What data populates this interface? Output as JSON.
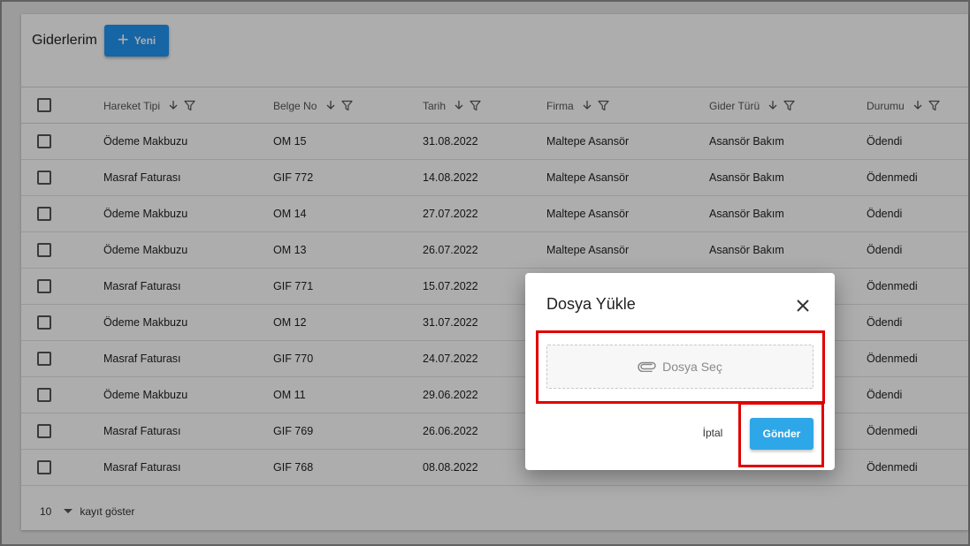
{
  "page": {
    "title": "Giderlerim",
    "new_button_label": "Yeni"
  },
  "table": {
    "columns": [
      "Hareket Tipi",
      "Belge No",
      "Tarih",
      "Firma",
      "Gider Türü",
      "Durumu"
    ],
    "rows": [
      [
        "Ödeme Makbuzu",
        "OM 15",
        "31.08.2022",
        "Maltepe Asansör",
        "Asansör Bakım",
        "Ödendi"
      ],
      [
        "Masraf Faturası",
        "GIF 772",
        "14.08.2022",
        "Maltepe Asansör",
        "Asansör Bakım",
        "Ödenmedi"
      ],
      [
        "Ödeme Makbuzu",
        "OM 14",
        "27.07.2022",
        "Maltepe Asansör",
        "Asansör Bakım",
        "Ödendi"
      ],
      [
        "Ödeme Makbuzu",
        "OM 13",
        "26.07.2022",
        "Maltepe Asansör",
        "Asansör Bakım",
        "Ödendi"
      ],
      [
        "Masraf Faturası",
        "GIF 771",
        "15.07.2022",
        "",
        "",
        "Ödenmedi"
      ],
      [
        "Ödeme Makbuzu",
        "OM 12",
        "31.07.2022",
        "",
        "",
        "Ödendi"
      ],
      [
        "Masraf Faturası",
        "GIF 770",
        "24.07.2022",
        "",
        "",
        "Ödenmedi"
      ],
      [
        "Ödeme Makbuzu",
        "OM 11",
        "29.06.2022",
        "",
        "",
        "Ödendi"
      ],
      [
        "Masraf Faturası",
        "GIF 769",
        "26.06.2022",
        "",
        "",
        "Ödenmedi"
      ],
      [
        "Masraf Faturası",
        "GIF 768",
        "08.08.2022",
        "",
        "",
        "Ödenmedi"
      ]
    ]
  },
  "footer": {
    "page_size": "10",
    "page_size_label": "kayıt göster"
  },
  "dialog": {
    "title": "Dosya Yükle",
    "upload_label": "Dosya Seç",
    "cancel_label": "İptal",
    "submit_label": "Gönder"
  },
  "icons": {
    "add": "plus-icon",
    "sort": "arrow-down-icon",
    "filter": "filter-icon",
    "attach": "paperclip-icon",
    "close": "close-icon",
    "dropdown": "caret-down-icon"
  },
  "colors": {
    "primary": "#2196f3",
    "submit": "#2ea7e8",
    "highlight": "#e00000"
  }
}
